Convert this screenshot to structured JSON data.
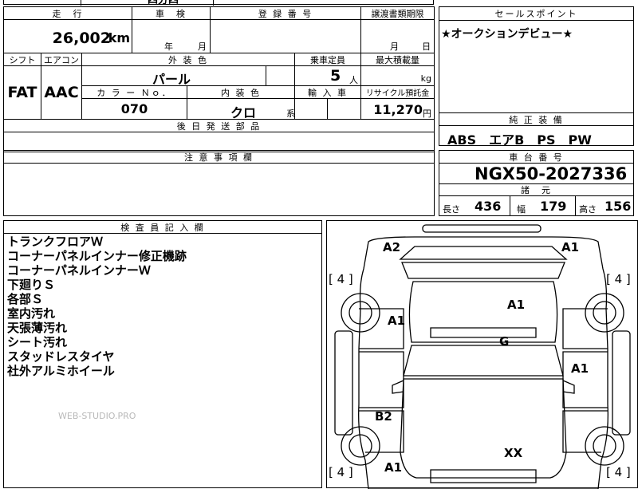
{
  "header": {
    "top_partial_1": "四分四",
    "top_partial_2": "…"
  },
  "mileage": {
    "label": "走　行",
    "value": "26,002",
    "unit": "km"
  },
  "shaken": {
    "label": "車　検",
    "year_unit": "年",
    "month_unit": "月"
  },
  "registration": {
    "label": "登 録 番 号"
  },
  "transfer": {
    "label": "譲渡書類期限",
    "month_unit": "月",
    "day_unit": "日"
  },
  "sales_point": {
    "label": "セールスポイント",
    "value": "★オークションデビュー★"
  },
  "shift": {
    "label": "シフト",
    "value": "FAT"
  },
  "aircon": {
    "label": "エアコン",
    "value": "AAC"
  },
  "exterior_color": {
    "label": "外 装 色",
    "value": "パール"
  },
  "capacity": {
    "label": "乗車定員",
    "value": "5",
    "unit": "人"
  },
  "max_load": {
    "label": "最大積載量",
    "unit": "kg"
  },
  "color_no": {
    "label": "カ ラ ー Ｎｏ．",
    "value": "070"
  },
  "interior_color": {
    "label": "内 装 色",
    "value": "クロ",
    "unit": "系"
  },
  "import": {
    "label": "輸 入 車"
  },
  "recycle": {
    "label": "リサイクル預託金",
    "value": "11,270",
    "unit": "円"
  },
  "later_parts": {
    "label": "後 日 発 送 部 品"
  },
  "genuine_equipment": {
    "label": "純 正 装 備",
    "value": "ABS　エアB　PS　PW"
  },
  "notes": {
    "label": "注 意 事 項 欄"
  },
  "chassis": {
    "label": "車 台 番 号",
    "value": "NGX50-2027336"
  },
  "specs": {
    "label": "諸　元",
    "length_label": "長さ",
    "length": "436",
    "width_label": "幅",
    "width": "179",
    "height_label": "高さ",
    "height": "156"
  },
  "inspector": {
    "label": "検 査 員 記 入 欄",
    "lines": [
      "トランクフロアＷ",
      "コーナーパネルインナー修正機跡",
      "コーナーパネルインナーＷ",
      "下廻りＳ",
      "各部Ｓ",
      "室内汚れ",
      "天張薄汚れ",
      "シート汚れ",
      "スタッドレスタイヤ",
      "社外アルミホイール"
    ]
  },
  "watermark": "WEB-STUDIO.PRO",
  "diagram": {
    "marks": {
      "rear_left": "A2",
      "rear_right": "A1",
      "roof": "A1",
      "left_rear_quarter": "A1",
      "glass": "G",
      "right_rear_door": "A1",
      "left_front_door": "B2",
      "hood": "XX",
      "left_front_fender": "A1"
    },
    "tires": {
      "rear_left": "[ 4 ]",
      "rear_right": "[ 4 ]",
      "front_left": "[ 4 ]",
      "front_right": "[ 4 ]"
    }
  }
}
